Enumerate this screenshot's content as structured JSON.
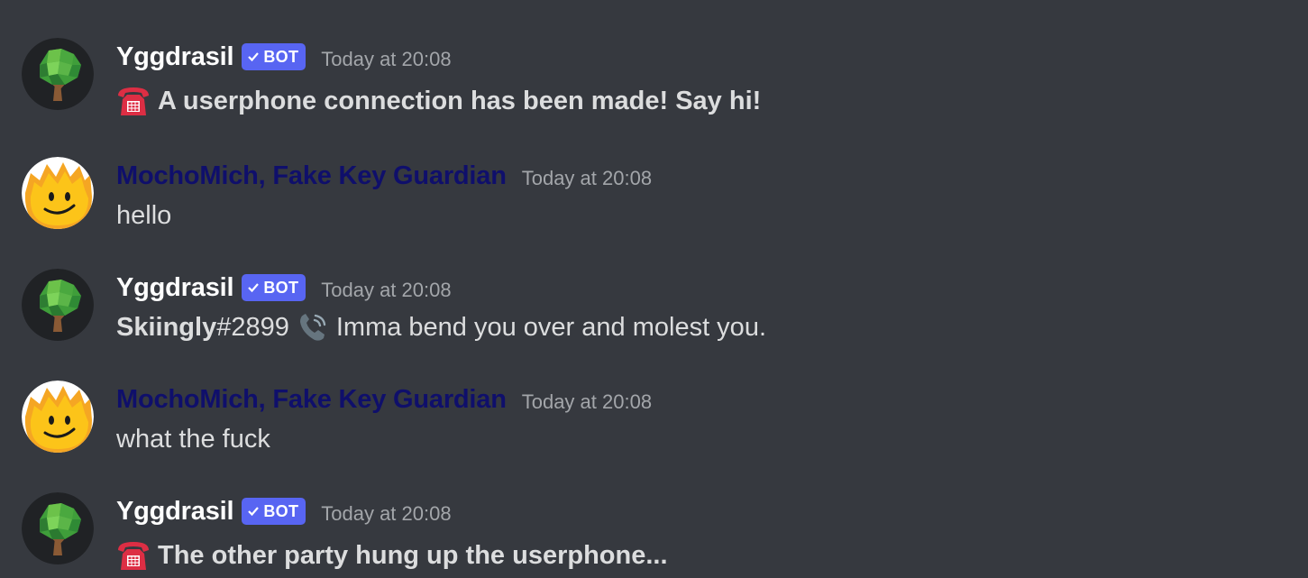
{
  "messages": [
    {
      "author": "Yggdrasil",
      "is_bot": true,
      "bot_label": "BOT",
      "timestamp": "Today at 20:08",
      "avatar_icon": "tree-icon",
      "emoji_icon": "telephone-icon",
      "text": "A userphone connection has been made! Say hi!"
    },
    {
      "author": "MochoMich, Fake Key Guardian",
      "is_bot": false,
      "timestamp": "Today at 20:08",
      "avatar_icon": "flame-face-icon",
      "text": "hello"
    },
    {
      "author": "Yggdrasil",
      "is_bot": true,
      "bot_label": "BOT",
      "timestamp": "Today at 20:08",
      "avatar_icon": "tree-icon",
      "sender_name": "Skiingly",
      "sender_discriminator": "#2899",
      "emoji_icon": "phone-receiver-icon",
      "text": "Imma bend you over and molest you."
    },
    {
      "author": "MochoMich, Fake Key Guardian",
      "is_bot": false,
      "timestamp": "Today at 20:08",
      "avatar_icon": "flame-face-icon",
      "text": "what the fuck"
    },
    {
      "author": "Yggdrasil",
      "is_bot": true,
      "bot_label": "BOT",
      "timestamp": "Today at 20:08",
      "avatar_icon": "tree-icon",
      "emoji_icon": "telephone-icon",
      "text": "The other party hung up the userphone..."
    }
  ],
  "colors": {
    "background": "#36393f",
    "bot_tag": "#5865f2",
    "member_name": "#0f0f6b",
    "timestamp": "#a3a6aa",
    "text": "#dcddde"
  }
}
